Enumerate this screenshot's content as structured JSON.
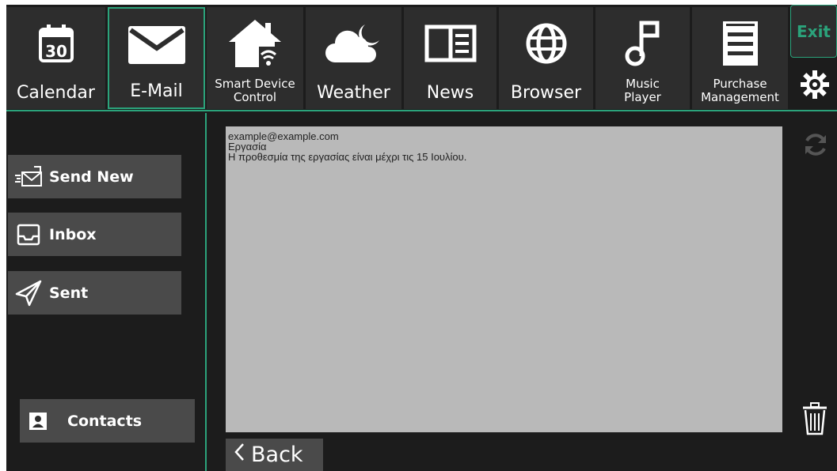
{
  "apps": [
    {
      "label": "Calendar",
      "icon": "calendar-icon",
      "day": "30"
    },
    {
      "label": "E-Mail",
      "icon": "mail-icon"
    },
    {
      "label": "Smart Device Control",
      "icon": "smart-home-icon"
    },
    {
      "label": "Weather",
      "icon": "weather-icon"
    },
    {
      "label": "News",
      "icon": "news-icon"
    },
    {
      "label": "Browser",
      "icon": "globe-icon"
    },
    {
      "label": "Music Player",
      "icon": "music-note-icon"
    },
    {
      "label": "Purchase Management",
      "icon": "receipt-icon"
    }
  ],
  "active_app": "E-Mail",
  "exit_label": "Exit",
  "sidebar": {
    "send_new": "Send New",
    "inbox": "Inbox",
    "sent": "Sent",
    "contacts": "Contacts"
  },
  "message": {
    "from": "example@example.com",
    "subject": "Εργασία",
    "body": "Η προθεσμία της εργασίας είναι μέχρι τις 15 Ιουλίου."
  },
  "back_label": "Back",
  "colors": {
    "accent": "#2ba37b",
    "background": "#1c1c1c",
    "tile": "#2d2d2d",
    "button": "#4a4a4a",
    "message_bg": "#b9b9b9"
  }
}
